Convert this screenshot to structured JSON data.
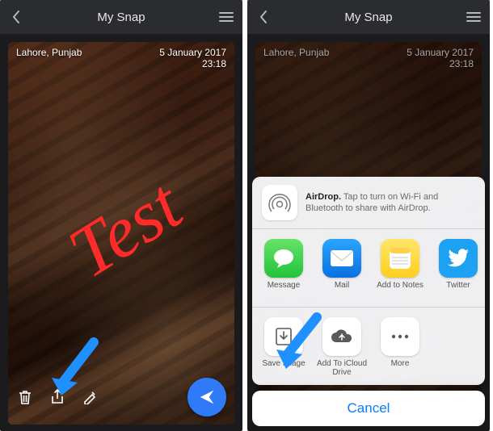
{
  "left": {
    "title": "My Snap",
    "location": "Lahore, Punjab",
    "date": "5 January 2017",
    "time": "23:18",
    "drawing_text": "Test"
  },
  "right": {
    "title": "My Snap",
    "location": "Lahore, Punjab",
    "date": "5 January 2017",
    "time": "23:18",
    "airdrop_bold": "AirDrop.",
    "airdrop_text": " Tap to turn on Wi-Fi and Bluetooth to share with AirDrop.",
    "apps": [
      {
        "label": "Message"
      },
      {
        "label": "Mail"
      },
      {
        "label": "Add to Notes"
      },
      {
        "label": "Twitter"
      }
    ],
    "actions": [
      {
        "label": "Save Image"
      },
      {
        "label": "Add To iCloud Drive"
      },
      {
        "label": "More"
      }
    ],
    "cancel": "Cancel"
  }
}
